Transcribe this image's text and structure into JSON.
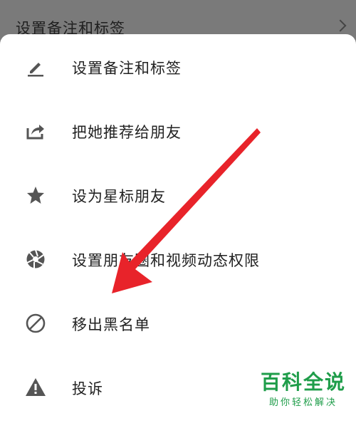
{
  "background_row": {
    "label": "设置备注和标签"
  },
  "menu": {
    "items": [
      {
        "label": "设置备注和标签",
        "icon": "pencil-icon"
      },
      {
        "label": "把她推荐给朋友",
        "icon": "share-icon"
      },
      {
        "label": "设为星标朋友",
        "icon": "star-icon"
      },
      {
        "label": "设置朋友圈和视频动态权限",
        "icon": "aperture-icon"
      },
      {
        "label": "移出黑名单",
        "icon": "block-icon"
      },
      {
        "label": "投诉",
        "icon": "warning-icon"
      }
    ]
  },
  "watermark": {
    "title": "百科全说",
    "subtitle": "助你轻松解决"
  },
  "colors": {
    "arrow": "#e8232a",
    "watermark": "#1f9d4a",
    "icon": "#555555"
  }
}
